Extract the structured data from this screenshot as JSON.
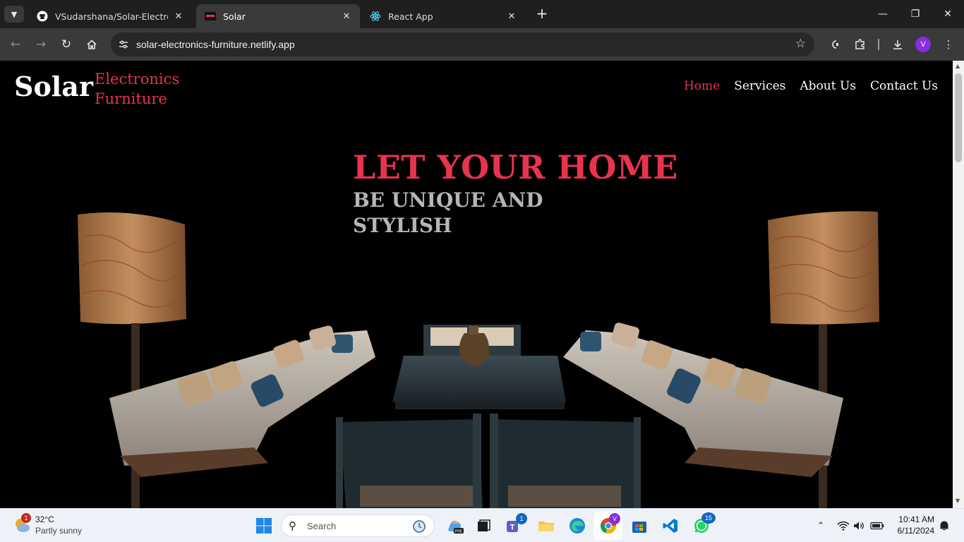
{
  "browser": {
    "tabs": [
      {
        "title": "VSudarshana/Solar-Electronics-",
        "favicon": "github-icon",
        "active": false
      },
      {
        "title": "Solar",
        "favicon": "solar-favicon",
        "active": true
      },
      {
        "title": "React App",
        "favicon": "react-icon",
        "active": false
      }
    ],
    "url": "solar-electronics-furniture.netlify.app",
    "profile_initial": "V"
  },
  "site": {
    "brand": "Solar",
    "brand_sub_1": "Electronics",
    "brand_sub_2": "Furniture",
    "nav": [
      {
        "label": "Home",
        "active": true
      },
      {
        "label": "Services",
        "active": false
      },
      {
        "label": "About Us",
        "active": false
      },
      {
        "label": "Contact Us",
        "active": false
      }
    ],
    "hero_title": "LET YOUR HOME",
    "hero_sub_1": "BE UNIQUE AND",
    "hero_sub_2": "STYLISH"
  },
  "taskbar": {
    "weather_temp": "32°C",
    "weather_desc": "Partly sunny",
    "weather_badge": "1",
    "search_placeholder": "Search",
    "teams_badge": "1",
    "chrome_badge": "V",
    "whatsapp_badge": "15",
    "time": "10:41 AM",
    "date": "6/11/2024"
  },
  "colors": {
    "accent": "#e8334f",
    "page_bg": "#000000",
    "chrome_dark": "#1f1f1f",
    "toolbar": "#3a3a3a"
  }
}
